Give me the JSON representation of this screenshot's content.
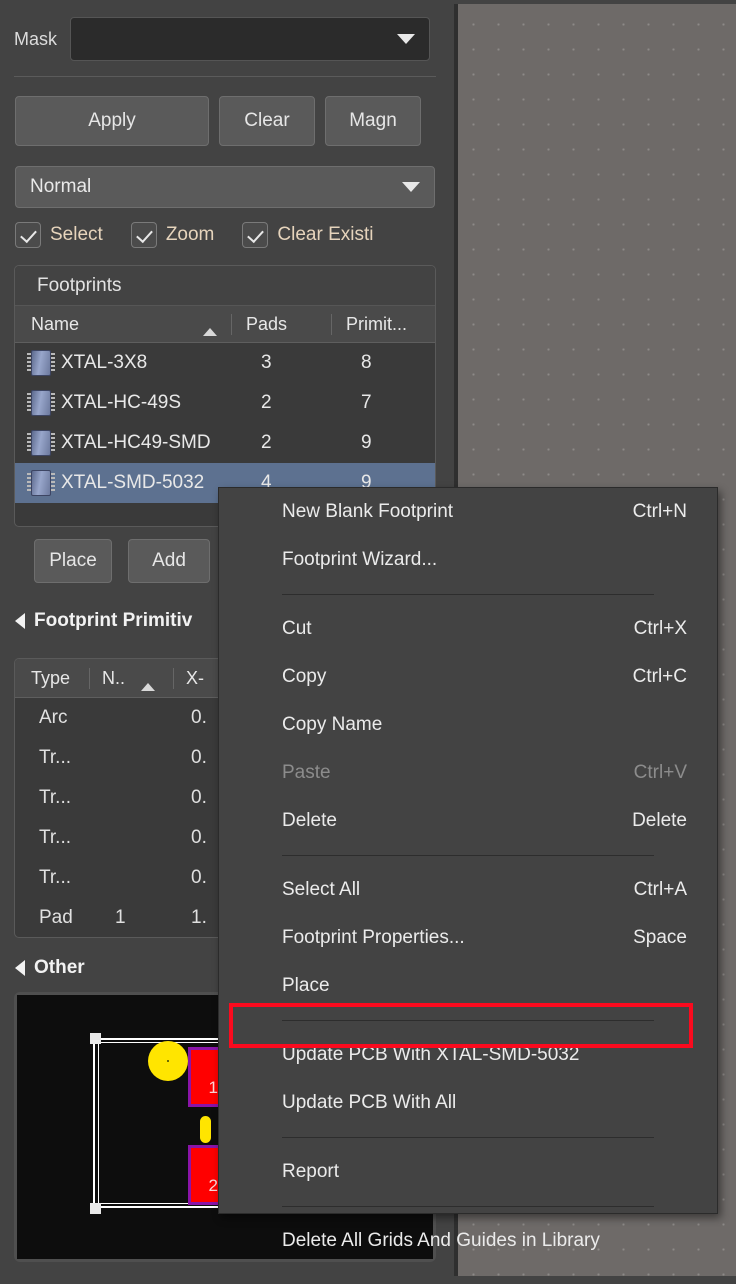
{
  "panel": {
    "mask": {
      "label": "Mask",
      "value": "",
      "arrow_icon": "chevron-down-icon"
    },
    "buttons": {
      "apply": "Apply",
      "clear": "Clear",
      "magnify": "Magn"
    },
    "mode_select": {
      "value": "Normal",
      "arrow_icon": "chevron-down-icon"
    },
    "checkboxes": [
      {
        "label": "Select",
        "checked": true
      },
      {
        "label": "Zoom",
        "checked": true
      },
      {
        "label": "Clear Existi",
        "checked": true
      }
    ],
    "footprints": {
      "title": "Footprints",
      "columns": [
        "Name",
        "Pads",
        "Primit..."
      ],
      "sort_column": "Name",
      "sort_direction": "ascending",
      "rows": [
        {
          "name": "XTAL-3X8",
          "pads": "3",
          "primitives": "8",
          "selected": false
        },
        {
          "name": "XTAL-HC-49S",
          "pads": "2",
          "primitives": "7",
          "selected": false
        },
        {
          "name": "XTAL-HC49-SMD",
          "pads": "2",
          "primitives": "9",
          "selected": false
        },
        {
          "name": "XTAL-SMD-5032",
          "pads": "4",
          "primitives": "9",
          "selected": true
        }
      ]
    },
    "list_buttons": {
      "place": "Place",
      "add": "Add"
    },
    "primitives_section": {
      "title": "Footprint Primitiv",
      "columns": [
        "Type",
        "N..",
        "X-"
      ],
      "sort_column": "N..",
      "sort_direction": "ascending",
      "rows": [
        {
          "type": "Arc",
          "n": "",
          "x": "0."
        },
        {
          "type": "Tr...",
          "n": "",
          "x": "0."
        },
        {
          "type": "Tr...",
          "n": "",
          "x": "0."
        },
        {
          "type": "Tr...",
          "n": "",
          "x": "0."
        },
        {
          "type": "Tr...",
          "n": "",
          "x": "0."
        },
        {
          "type": "Pad",
          "n": "1",
          "x": "1."
        }
      ]
    },
    "other_section": {
      "title": "Other"
    },
    "preview": {
      "pad1_label": "1",
      "pad2_label": "2",
      "pad_fill_color": "#ff0000",
      "pad_outline_color": "#8a14a8",
      "marker_color": "#ffe500",
      "outline_color": "#ffffff",
      "background_color": "#0d0d0d"
    }
  },
  "context_menu": {
    "items": [
      {
        "label": "New Blank Footprint",
        "accel": "Ctrl+N",
        "disabled": false,
        "separator_after": false
      },
      {
        "label": "Footprint Wizard...",
        "accel": "",
        "disabled": false,
        "separator_after": true
      },
      {
        "label": "Cut",
        "accel": "Ctrl+X",
        "disabled": false,
        "separator_after": false
      },
      {
        "label": "Copy",
        "accel": "Ctrl+C",
        "disabled": false,
        "separator_after": false
      },
      {
        "label": "Copy Name",
        "accel": "",
        "disabled": false,
        "separator_after": false
      },
      {
        "label": "Paste",
        "accel": "Ctrl+V",
        "disabled": true,
        "separator_after": false
      },
      {
        "label": "Delete",
        "accel": "Delete",
        "disabled": false,
        "separator_after": true
      },
      {
        "label": "Select All",
        "accel": "Ctrl+A",
        "disabled": false,
        "separator_after": false
      },
      {
        "label": "Footprint Properties...",
        "accel": "Space",
        "disabled": false,
        "separator_after": false
      },
      {
        "label": "Place",
        "accel": "",
        "disabled": false,
        "separator_after": true
      },
      {
        "label": "Update PCB With XTAL-SMD-5032",
        "accel": "",
        "disabled": false,
        "separator_after": false,
        "highlighted": true
      },
      {
        "label": "Update PCB With All",
        "accel": "",
        "disabled": false,
        "separator_after": true
      },
      {
        "label": "Report",
        "accel": "",
        "disabled": false,
        "separator_after": true
      },
      {
        "label": "Delete All Grids And Guides in Library",
        "accel": "",
        "disabled": false,
        "separator_after": false
      }
    ],
    "highlight_color": "#fb0a1e"
  },
  "canvas": {
    "grid_color": "#8d8a88",
    "background_color": "#6e6a68"
  }
}
